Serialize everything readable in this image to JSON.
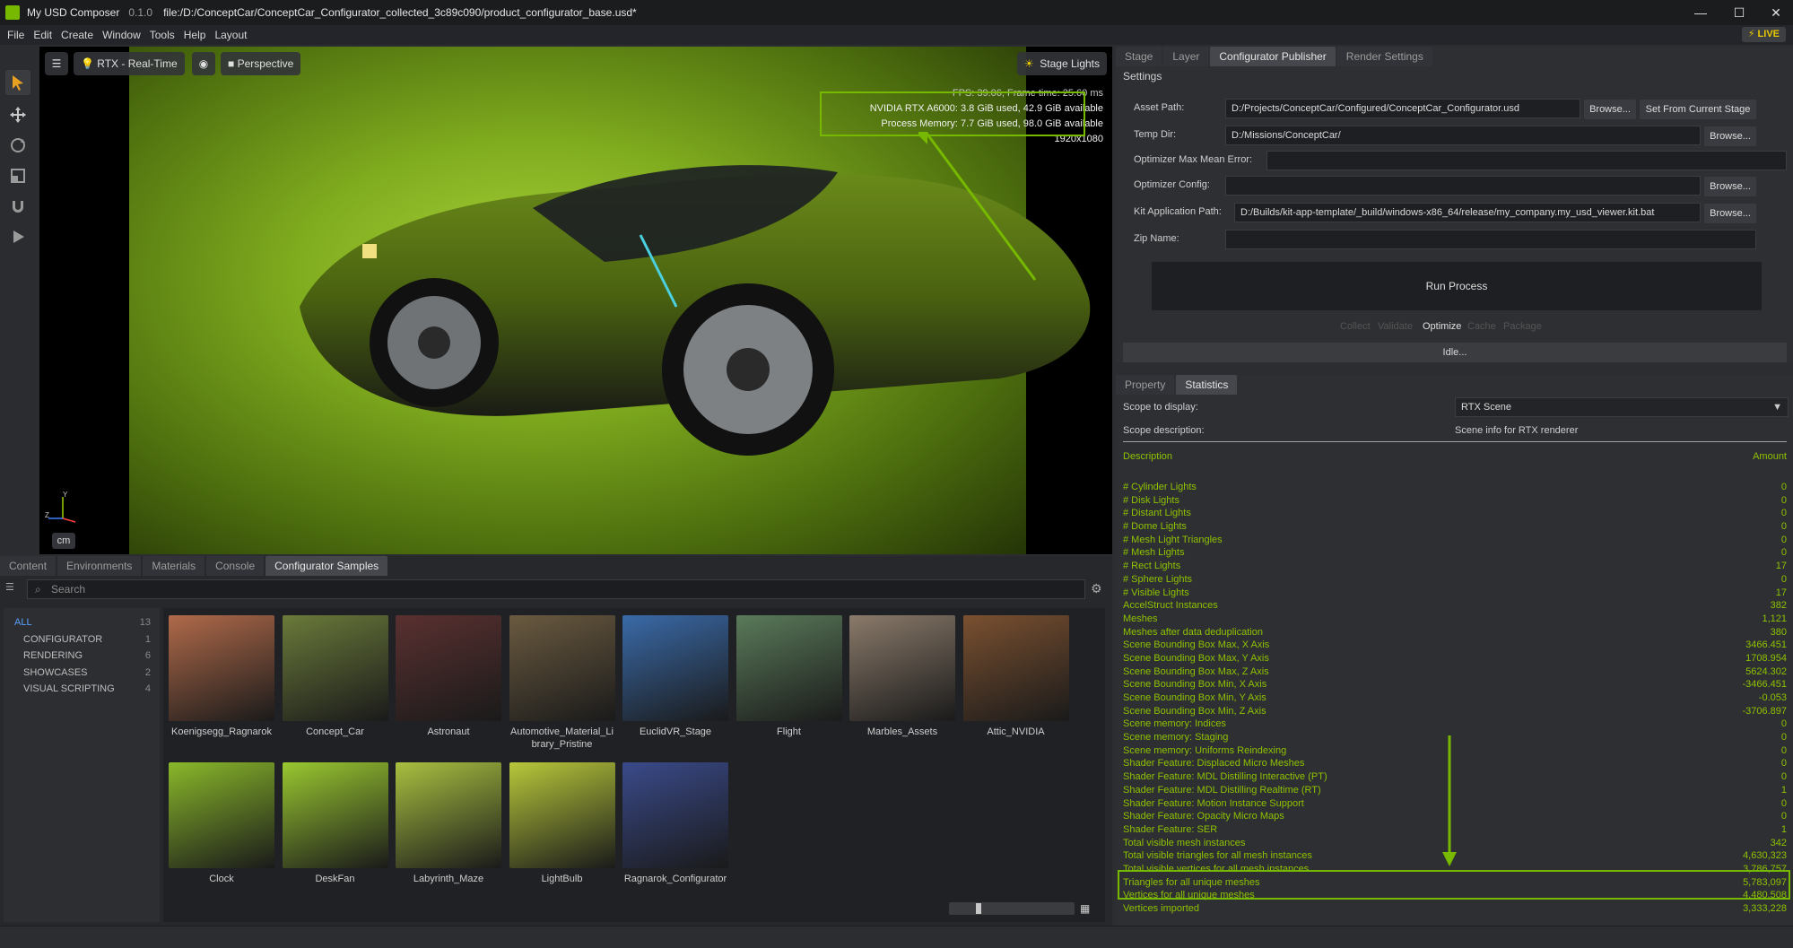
{
  "window": {
    "app_name": "My USD Composer",
    "version": "0.1.0",
    "file_path": "file:/D:/ConceptCar/ConceptCar_Configurator_collected_3c89c090/product_configurator_base.usd*"
  },
  "menu": [
    "File",
    "Edit",
    "Create",
    "Window",
    "Tools",
    "Help",
    "Layout"
  ],
  "live_badge": "LIVE",
  "toolbar_icons": [
    "select-icon",
    "move-icon",
    "rotate-icon",
    "scale-icon",
    "snap-icon",
    "play-icon"
  ],
  "viewport": {
    "render_mode": "RTX - Real-Time",
    "camera": "Perspective",
    "lights": "Stage Lights",
    "fps_line": "FPS: 39.06, Frame time: 25.60 ms",
    "gpu_line": "NVIDIA RTX A6000: 3.8 GiB used, 42.9 GiB available",
    "mem_line": "Process Memory: 7.7 GiB used, 98.0 GiB available",
    "resolution": "1920x1080",
    "unit": "cm",
    "axis_y": "Y",
    "axis_z": "Z"
  },
  "publisher": {
    "tabs": [
      "Stage",
      "Layer",
      "Configurator Publisher",
      "Render Settings"
    ],
    "active_tab": "Configurator Publisher",
    "section": "Settings",
    "asset_path_label": "Asset Path:",
    "asset_path": "D:/Projects/ConceptCar/Configured/ConceptCar_Configurator.usd",
    "browse": "Browse...",
    "set_from_stage": "Set From Current Stage",
    "temp_dir_label": "Temp Dir:",
    "temp_dir": "D:/Missions/ConceptCar/",
    "optimizer_error_label": "Optimizer Max Mean Error:",
    "optimizer_config_label": "Optimizer Config:",
    "kit_path_label": "Kit Application Path:",
    "kit_path": "D:/Builds/kit-app-template/_build/windows-x86_64/release/my_company.my_usd_viewer.kit.bat",
    "zip_label": "Zip Name:",
    "run_process": "Run Process",
    "steps": [
      "Collect",
      "Validate",
      "Optimize",
      "Cache",
      "Package"
    ],
    "status": "Idle..."
  },
  "stats": {
    "tabs": [
      "Property",
      "Statistics"
    ],
    "active_tab": "Statistics",
    "scope_label": "Scope to display:",
    "scope_value": "RTX Scene",
    "scope_desc_label": "Scope description:",
    "scope_desc_value": "Scene info for RTX renderer",
    "col_description": "Description",
    "col_amount": "Amount",
    "rows": [
      {
        "d": "# Cylinder Lights",
        "a": "0"
      },
      {
        "d": "# Disk Lights",
        "a": "0"
      },
      {
        "d": "# Distant Lights",
        "a": "0"
      },
      {
        "d": "# Dome Lights",
        "a": "0"
      },
      {
        "d": "# Mesh Light Triangles",
        "a": "0"
      },
      {
        "d": "# Mesh Lights",
        "a": "0"
      },
      {
        "d": "# Rect Lights",
        "a": "17"
      },
      {
        "d": "# Sphere Lights",
        "a": "0"
      },
      {
        "d": "# Visible Lights",
        "a": "17"
      },
      {
        "d": "AccelStruct Instances",
        "a": "382"
      },
      {
        "d": "Meshes",
        "a": "1,121"
      },
      {
        "d": "Meshes after data deduplication",
        "a": "380"
      },
      {
        "d": "Scene Bounding Box Max, X Axis",
        "a": "3466.451"
      },
      {
        "d": "Scene Bounding Box Max, Y Axis",
        "a": "1708.954"
      },
      {
        "d": "Scene Bounding Box Max, Z Axis",
        "a": "5624.302"
      },
      {
        "d": "Scene Bounding Box Min, X Axis",
        "a": "-3466.451"
      },
      {
        "d": "Scene Bounding Box Min, Y Axis",
        "a": "-0.053"
      },
      {
        "d": "Scene Bounding Box Min, Z Axis",
        "a": "-3706.897"
      },
      {
        "d": "Scene memory: Indices",
        "a": "0"
      },
      {
        "d": "Scene memory: Staging",
        "a": "0"
      },
      {
        "d": "Scene memory: Uniforms Reindexing",
        "a": "0"
      },
      {
        "d": "Shader Feature: Displaced Micro Meshes",
        "a": "0"
      },
      {
        "d": "Shader Feature: MDL Distilling Interactive (PT)",
        "a": "0"
      },
      {
        "d": "Shader Feature: MDL Distilling Realtime (RT)",
        "a": "1"
      },
      {
        "d": "Shader Feature: Motion Instance Support",
        "a": "0"
      },
      {
        "d": "Shader Feature: Opacity Micro Maps",
        "a": "0"
      },
      {
        "d": "Shader Feature: SER",
        "a": "1"
      },
      {
        "d": "Total visible mesh instances",
        "a": "342"
      },
      {
        "d": "Total visible triangles for all mesh instances",
        "a": "4,630,323"
      },
      {
        "d": "Total visible vertices for all mesh instances",
        "a": "3,786,757"
      },
      {
        "d": "Triangles for all unique meshes",
        "a": "5,783,097"
      },
      {
        "d": "Vertices for all unique meshes",
        "a": "4,480,508"
      },
      {
        "d": "Vertices imported",
        "a": "3,333,228"
      }
    ]
  },
  "browser": {
    "tabs": [
      "Content",
      "Environments",
      "Materials",
      "Console",
      "Configurator Samples"
    ],
    "active_tab": "Configurator Samples",
    "search_placeholder": "Search",
    "tree": [
      {
        "label": "ALL",
        "count": "13"
      },
      {
        "label": "CONFIGURATOR",
        "count": "1"
      },
      {
        "label": "RENDERING",
        "count": "6"
      },
      {
        "label": "SHOWCASES",
        "count": "2"
      },
      {
        "label": "VISUAL SCRIPTING",
        "count": "4"
      }
    ],
    "items": [
      {
        "name": "Koenigsegg_Ragnarok",
        "color": "#b06a4a"
      },
      {
        "name": "Concept_Car",
        "color": "#6a7a3a"
      },
      {
        "name": "Astronaut",
        "color": "#5a3030"
      },
      {
        "name": "Automotive_Material_Library_Pristine",
        "color": "#6a5a40"
      },
      {
        "name": "EuclidVR_Stage",
        "color": "#3a6aa8"
      },
      {
        "name": "Flight",
        "color": "#5a7a5a"
      },
      {
        "name": "Marbles_Assets",
        "color": "#8a7a6a"
      },
      {
        "name": "Attic_NVIDIA",
        "color": "#7a5030"
      },
      {
        "name": "Clock",
        "color": "#8ab82a"
      },
      {
        "name": "DeskFan",
        "color": "#9ac830"
      },
      {
        "name": "Labyrinth_Maze",
        "color": "#a8c040"
      },
      {
        "name": "LightBulb",
        "color": "#b8c83a"
      },
      {
        "name": "Ragnarok_Configurator",
        "color": "#3a4a8a"
      }
    ]
  },
  "colors": {
    "accent": "#76b900",
    "stats_text": "#8fc200",
    "live": "#e8c800"
  }
}
